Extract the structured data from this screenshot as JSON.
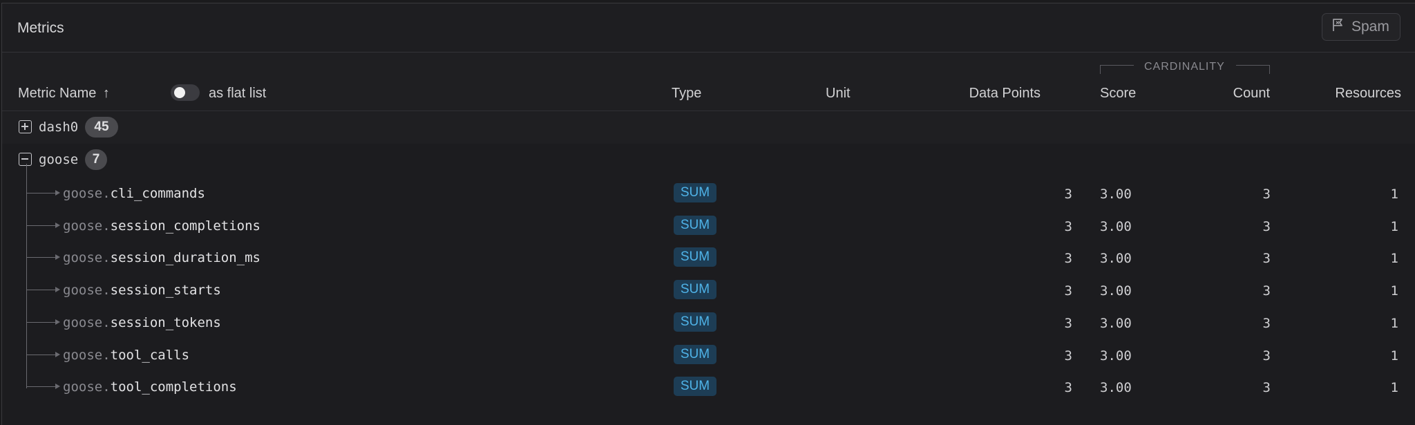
{
  "header": {
    "title": "Metrics",
    "spam_label": "Spam"
  },
  "columns": {
    "metric_name": "Metric Name",
    "sort_arrow": "↑",
    "flat_list_label": "as flat list",
    "type": "Type",
    "unit": "Unit",
    "data_points": "Data Points",
    "cardinality": "CARDINALITY",
    "score": "Score",
    "count": "Count",
    "resources": "Resources"
  },
  "groups": [
    {
      "name": "dash0",
      "count": "45",
      "expanded": false
    },
    {
      "name": "goose",
      "count": "7",
      "expanded": true
    }
  ],
  "metrics": [
    {
      "prefix": "goose.",
      "name": "cli_commands",
      "type": "SUM",
      "data_points": "3",
      "score": "3.00",
      "count": "3",
      "resources": "1"
    },
    {
      "prefix": "goose.",
      "name": "session_completions",
      "type": "SUM",
      "data_points": "3",
      "score": "3.00",
      "count": "3",
      "resources": "1"
    },
    {
      "prefix": "goose.",
      "name": "session_duration_ms",
      "type": "SUM",
      "data_points": "3",
      "score": "3.00",
      "count": "3",
      "resources": "1"
    },
    {
      "prefix": "goose.",
      "name": "session_starts",
      "type": "SUM",
      "data_points": "3",
      "score": "3.00",
      "count": "3",
      "resources": "1"
    },
    {
      "prefix": "goose.",
      "name": "session_tokens",
      "type": "SUM",
      "data_points": "3",
      "score": "3.00",
      "count": "3",
      "resources": "1"
    },
    {
      "prefix": "goose.",
      "name": "tool_calls",
      "type": "SUM",
      "data_points": "3",
      "score": "3.00",
      "count": "3",
      "resources": "1"
    },
    {
      "prefix": "goose.",
      "name": "tool_completions",
      "type": "SUM",
      "data_points": "3",
      "score": "3.00",
      "count": "3",
      "resources": "1"
    }
  ],
  "colors": {
    "background": "#1b1b1d",
    "sum_badge_bg": "#1d3d55",
    "sum_badge_text": "#4fb3e8",
    "count_badge_bg": "#4a4a4e"
  },
  "icons": {
    "spam": "flag-icon",
    "collapsed": "plus-square-icon",
    "expanded": "minus-square-icon"
  }
}
